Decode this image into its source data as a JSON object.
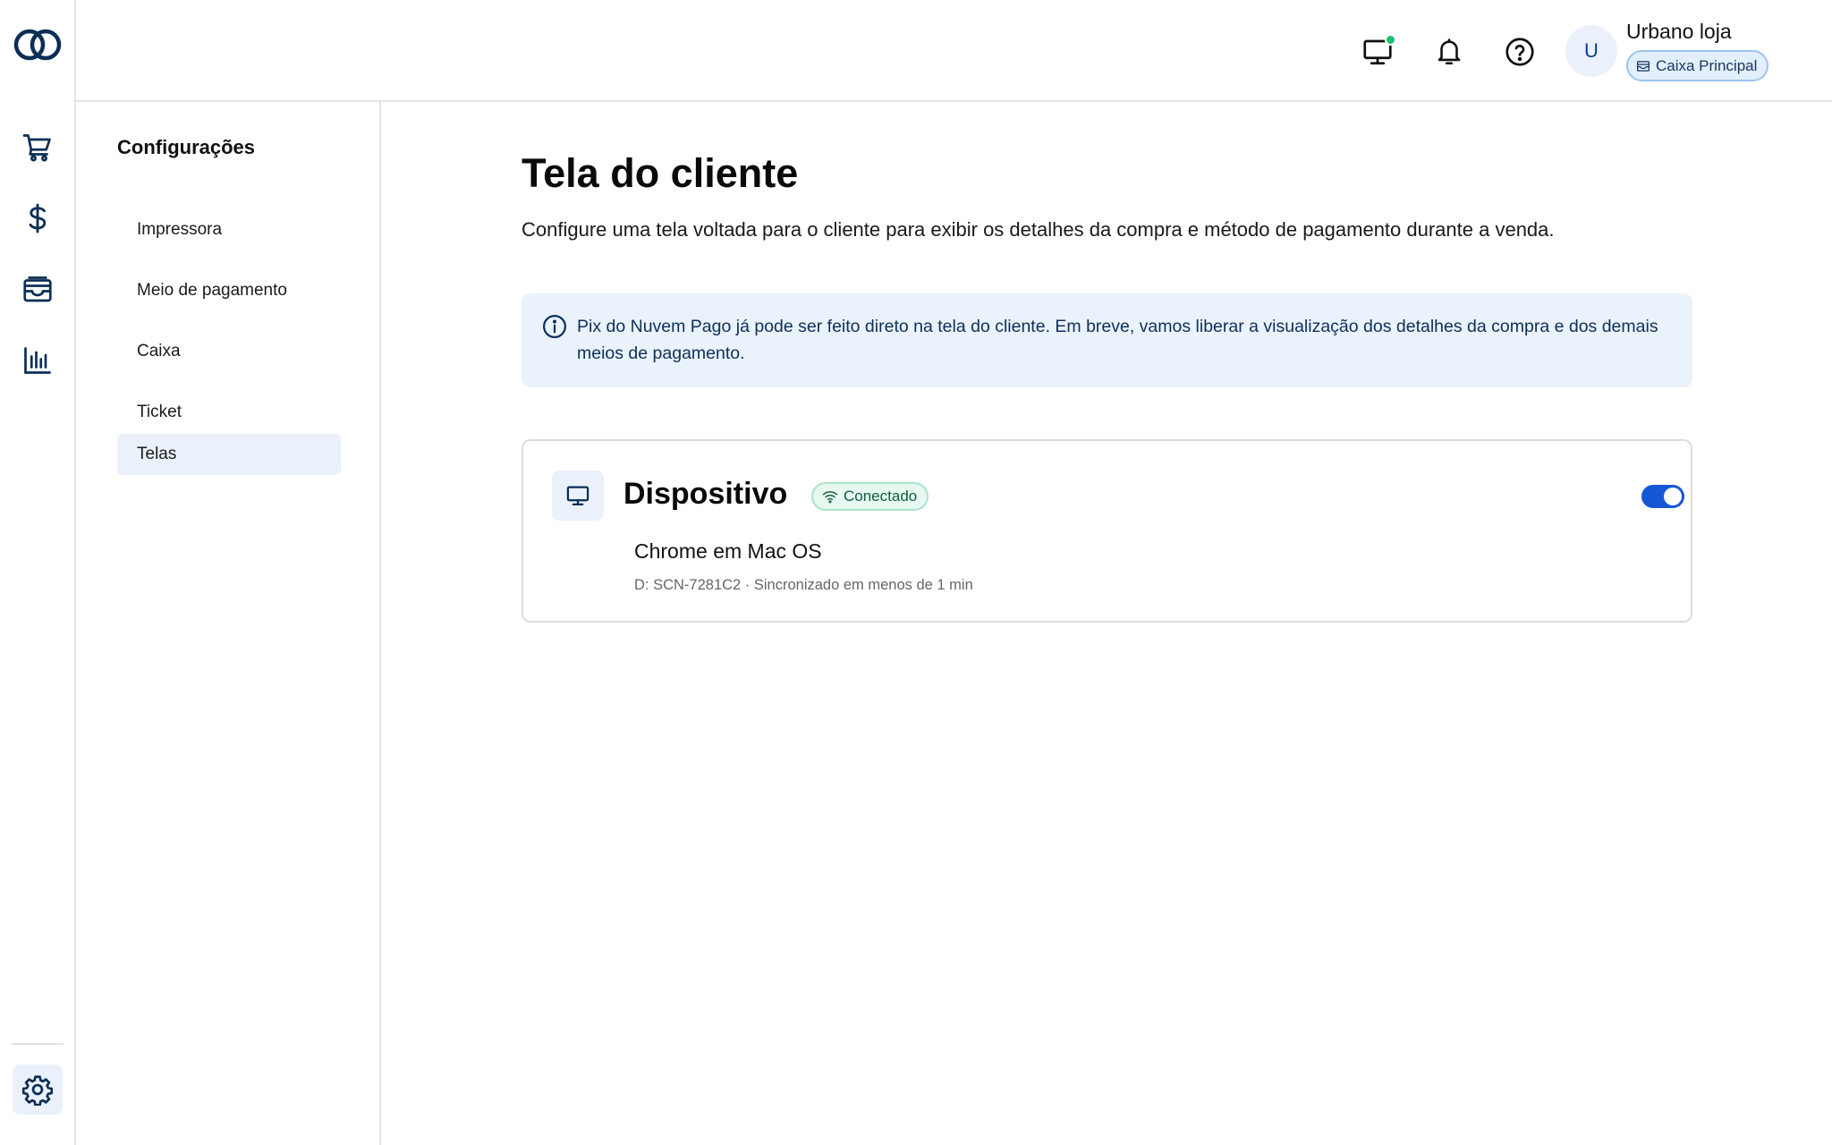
{
  "topbar": {
    "store_name": "Urbano loja",
    "avatar_initial": "U",
    "cash_register": "Caixa Principal",
    "icons": [
      "monitor-icon",
      "bell-icon",
      "help-icon",
      "chevron-down-icon"
    ],
    "monitor_status_color": "#1dbf73"
  },
  "rail": {
    "items": [
      "cart-icon",
      "dollar-icon",
      "cash-drawer-icon",
      "bar-chart-icon",
      "gear-icon"
    ],
    "active": "gear-icon"
  },
  "settings_nav": {
    "title": "Configurações",
    "items": [
      {
        "label": "Impressora"
      },
      {
        "label": "Meio de pagamento"
      },
      {
        "label": "Caixa"
      },
      {
        "label": "Ticket"
      },
      {
        "label": "Telas"
      }
    ],
    "active_label": "Telas"
  },
  "main": {
    "title": "Tela do cliente",
    "description": "Configure uma tela voltada para o cliente para exibir os detalhes da compra e método de pagamento durante a venda.",
    "info_banner": "Pix do Nuvem Pago já pode ser feito direto na tela do cliente. Em breve, vamos liberar a visualização dos detalhes da compra e dos demais meios de pagamento.",
    "device": {
      "title": "Dispositivo",
      "status": "Conectado",
      "enabled": true,
      "browser": "Chrome em Mac OS",
      "meta": "D: SCN-7281C2 · Sincronizado em menos de 1 min"
    }
  },
  "colors": {
    "accent": "#1557d6",
    "active_bg": "#eaf1fb",
    "success": "#1dbf73",
    "brand_dark": "#0b2e55"
  }
}
